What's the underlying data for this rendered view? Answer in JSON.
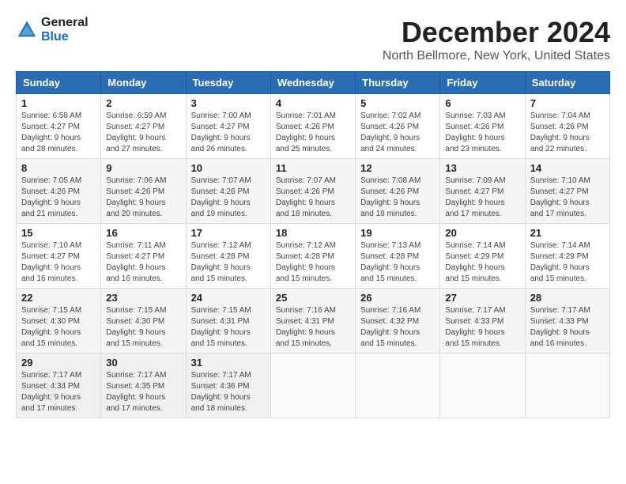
{
  "header": {
    "logo_line1": "General",
    "logo_line2": "Blue",
    "month_title": "December 2024",
    "location": "North Bellmore, New York, United States"
  },
  "weekdays": [
    "Sunday",
    "Monday",
    "Tuesday",
    "Wednesday",
    "Thursday",
    "Friday",
    "Saturday"
  ],
  "weeks": [
    [
      {
        "day": "1",
        "sunrise": "6:58 AM",
        "sunset": "4:27 PM",
        "daylight": "9 hours and 28 minutes."
      },
      {
        "day": "2",
        "sunrise": "6:59 AM",
        "sunset": "4:27 PM",
        "daylight": "9 hours and 27 minutes."
      },
      {
        "day": "3",
        "sunrise": "7:00 AM",
        "sunset": "4:27 PM",
        "daylight": "9 hours and 26 minutes."
      },
      {
        "day": "4",
        "sunrise": "7:01 AM",
        "sunset": "4:26 PM",
        "daylight": "9 hours and 25 minutes."
      },
      {
        "day": "5",
        "sunrise": "7:02 AM",
        "sunset": "4:26 PM",
        "daylight": "9 hours and 24 minutes."
      },
      {
        "day": "6",
        "sunrise": "7:03 AM",
        "sunset": "4:26 PM",
        "daylight": "9 hours and 23 minutes."
      },
      {
        "day": "7",
        "sunrise": "7:04 AM",
        "sunset": "4:26 PM",
        "daylight": "9 hours and 22 minutes."
      }
    ],
    [
      {
        "day": "8",
        "sunrise": "7:05 AM",
        "sunset": "4:26 PM",
        "daylight": "9 hours and 21 minutes."
      },
      {
        "day": "9",
        "sunrise": "7:06 AM",
        "sunset": "4:26 PM",
        "daylight": "9 hours and 20 minutes."
      },
      {
        "day": "10",
        "sunrise": "7:07 AM",
        "sunset": "4:26 PM",
        "daylight": "9 hours and 19 minutes."
      },
      {
        "day": "11",
        "sunrise": "7:07 AM",
        "sunset": "4:26 PM",
        "daylight": "9 hours and 18 minutes."
      },
      {
        "day": "12",
        "sunrise": "7:08 AM",
        "sunset": "4:26 PM",
        "daylight": "9 hours and 18 minutes."
      },
      {
        "day": "13",
        "sunrise": "7:09 AM",
        "sunset": "4:27 PM",
        "daylight": "9 hours and 17 minutes."
      },
      {
        "day": "14",
        "sunrise": "7:10 AM",
        "sunset": "4:27 PM",
        "daylight": "9 hours and 17 minutes."
      }
    ],
    [
      {
        "day": "15",
        "sunrise": "7:10 AM",
        "sunset": "4:27 PM",
        "daylight": "9 hours and 16 minutes."
      },
      {
        "day": "16",
        "sunrise": "7:11 AM",
        "sunset": "4:27 PM",
        "daylight": "9 hours and 16 minutes."
      },
      {
        "day": "17",
        "sunrise": "7:12 AM",
        "sunset": "4:28 PM",
        "daylight": "9 hours and 15 minutes."
      },
      {
        "day": "18",
        "sunrise": "7:12 AM",
        "sunset": "4:28 PM",
        "daylight": "9 hours and 15 minutes."
      },
      {
        "day": "19",
        "sunrise": "7:13 AM",
        "sunset": "4:28 PM",
        "daylight": "9 hours and 15 minutes."
      },
      {
        "day": "20",
        "sunrise": "7:14 AM",
        "sunset": "4:29 PM",
        "daylight": "9 hours and 15 minutes."
      },
      {
        "day": "21",
        "sunrise": "7:14 AM",
        "sunset": "4:29 PM",
        "daylight": "9 hours and 15 minutes."
      }
    ],
    [
      {
        "day": "22",
        "sunrise": "7:15 AM",
        "sunset": "4:30 PM",
        "daylight": "9 hours and 15 minutes."
      },
      {
        "day": "23",
        "sunrise": "7:15 AM",
        "sunset": "4:30 PM",
        "daylight": "9 hours and 15 minutes."
      },
      {
        "day": "24",
        "sunrise": "7:15 AM",
        "sunset": "4:31 PM",
        "daylight": "9 hours and 15 minutes."
      },
      {
        "day": "25",
        "sunrise": "7:16 AM",
        "sunset": "4:31 PM",
        "daylight": "9 hours and 15 minutes."
      },
      {
        "day": "26",
        "sunrise": "7:16 AM",
        "sunset": "4:32 PM",
        "daylight": "9 hours and 15 minutes."
      },
      {
        "day": "27",
        "sunrise": "7:17 AM",
        "sunset": "4:33 PM",
        "daylight": "9 hours and 15 minutes."
      },
      {
        "day": "28",
        "sunrise": "7:17 AM",
        "sunset": "4:33 PM",
        "daylight": "9 hours and 16 minutes."
      }
    ],
    [
      {
        "day": "29",
        "sunrise": "7:17 AM",
        "sunset": "4:34 PM",
        "daylight": "9 hours and 17 minutes."
      },
      {
        "day": "30",
        "sunrise": "7:17 AM",
        "sunset": "4:35 PM",
        "daylight": "9 hours and 17 minutes."
      },
      {
        "day": "31",
        "sunrise": "7:17 AM",
        "sunset": "4:36 PM",
        "daylight": "9 hours and 18 minutes."
      },
      null,
      null,
      null,
      null
    ]
  ]
}
